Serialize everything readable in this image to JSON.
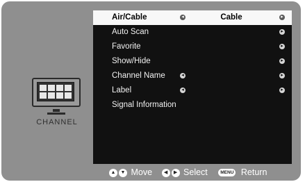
{
  "left_pane": {
    "channel_label": "CHANNEL",
    "icon": "monitor-icon"
  },
  "menu": {
    "items": [
      {
        "label": "Air/Cable",
        "value": "Cable",
        "selected": true
      },
      {
        "label": "Auto Scan"
      },
      {
        "label": "Favorite"
      },
      {
        "label": "Show/Hide"
      },
      {
        "label": "Channel Name"
      },
      {
        "label": "Label"
      },
      {
        "label": "Signal Information"
      }
    ]
  },
  "footer": {
    "move_label": "Move",
    "select_label": "Select",
    "menu_button": "MENU",
    "return_label": "Return"
  },
  "colors": {
    "frame": "#8f8f8f",
    "panel": "#111111",
    "highlight": "#f8f8f8",
    "text": "#f2f2f2"
  }
}
